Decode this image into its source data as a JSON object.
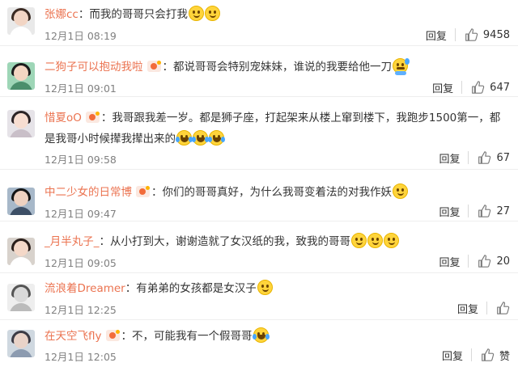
{
  "reply_label": "回复",
  "comments": [
    {
      "username": "张娜cc",
      "has_badge": false,
      "text": "：而我的哥哥只会打我",
      "emojis": [
        "smile",
        "smile"
      ],
      "time": "12月1日 08:19",
      "likes": "9458",
      "avatar": {
        "bg": "#e9e9e9",
        "hair": "#3a2a22",
        "skin": "#f2d5c4",
        "shirt": "#ffffff"
      }
    },
    {
      "username": "二狗子可以抱动我啦",
      "has_badge": true,
      "text": "：都说哥哥会特别宠妹妹，谁说的我要给他一刀",
      "emojis": [
        "sweat"
      ],
      "time": "12月1日 09:01",
      "likes": "647",
      "avatar": {
        "bg": "#9ed6b7",
        "hair": "#1c1c1c",
        "skin": "#f4d6c2",
        "shirt": "#4a8f6c"
      }
    },
    {
      "username": "惜夏oO",
      "has_badge": true,
      "text_line1": "：我哥跟我差一岁。都是狮子座，打起架来从楼上窜到楼下，我跑步1500第一，都",
      "text_line2": "是我哥小时候撵我撵出来的",
      "emojis": [
        "tears",
        "tears",
        "tears"
      ],
      "time": "12月1日 09:58",
      "likes": "67",
      "avatar": {
        "bg": "#e6e3e8",
        "hair": "#2b2326",
        "skin": "#f7ddd1",
        "shirt": "#c9bfc8"
      }
    },
    {
      "username": "中二少女的日常博",
      "has_badge": true,
      "text": "：你们的哥哥真好，为什么我哥变着法的对我作妖",
      "emojis": [
        "smile"
      ],
      "time": "12月1日 09:47",
      "likes": "27",
      "avatar": {
        "bg": "#a7b8c9",
        "hair": "#141414",
        "skin": "#eed1c0",
        "shirt": "#3d4f66"
      }
    },
    {
      "username": "_月半丸子_",
      "has_badge": false,
      "text": "：从小打到大，谢谢造就了女汉纸的我，致我的哥哥",
      "emojis": [
        "smile",
        "smile",
        "smile"
      ],
      "time": "12月1日 09:05",
      "likes": "20",
      "avatar": {
        "bg": "#d8d2cc",
        "hair": "#2a1e1a",
        "skin": "#f4d8c8",
        "shirt": "#ffffff"
      }
    },
    {
      "username": "流浪着Dreamer",
      "has_badge": false,
      "text": "：有弟弟的女孩都是女汉子",
      "emojis": [
        "smile"
      ],
      "time": "12月1日 12:25",
      "likes": "",
      "avatar": {
        "bg": "#eeeeee",
        "hair": "#555555",
        "skin": "#d9d9d9",
        "shirt": "#bbbbbb"
      }
    },
    {
      "username": "在天空飞fly",
      "has_badge": true,
      "text": "：不，可能我有一个假哥哥",
      "emojis": [
        "tears"
      ],
      "time": "12月1日 12:05",
      "likes": "赞",
      "avatar": {
        "bg": "#cfd8e0",
        "hair": "#3b3b45",
        "skin": "#e9d3c8",
        "shirt": "#8c9bb0"
      }
    }
  ]
}
